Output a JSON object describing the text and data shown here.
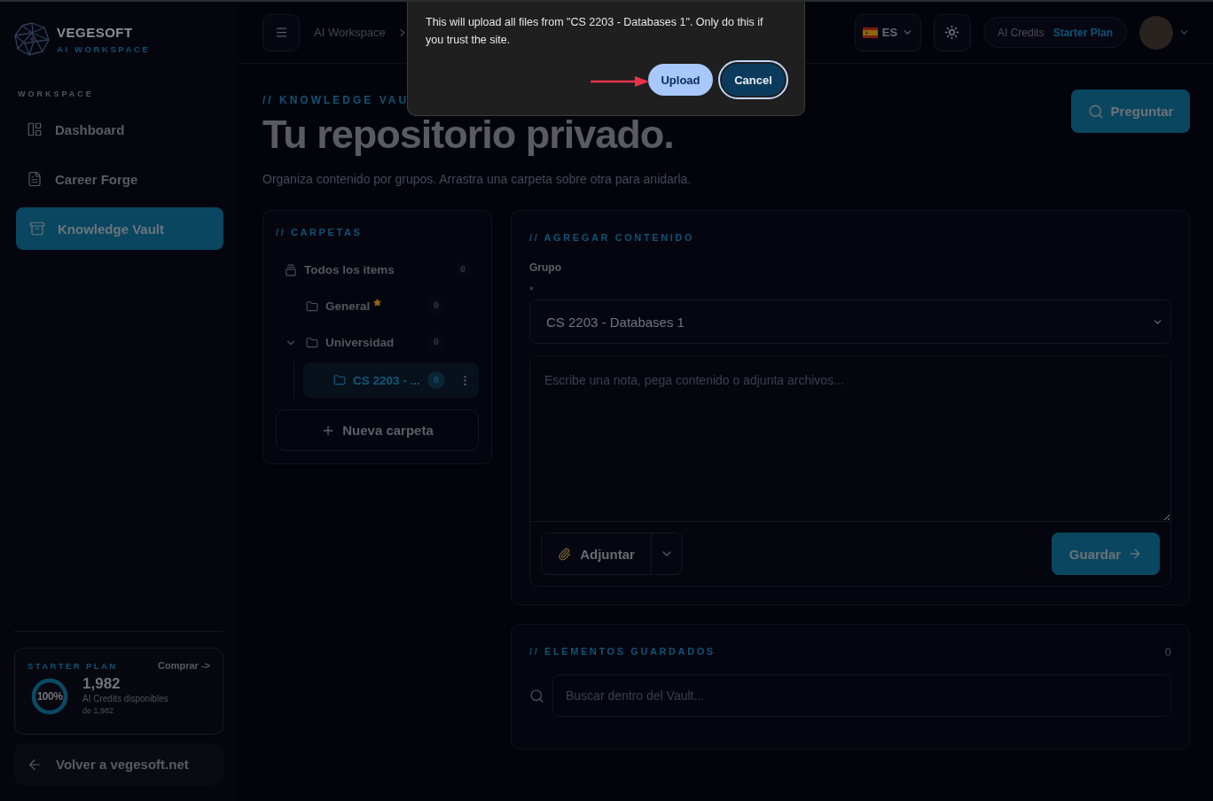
{
  "sidebar": {
    "brand": {
      "name": "VEGESOFT",
      "tagline": "AI WORKSPACE"
    },
    "section_label": "WORKSPACE",
    "items": [
      {
        "label": "Dashboard",
        "selected": false
      },
      {
        "label": "Career Forge",
        "selected": false
      },
      {
        "label": "Knowledge Vault",
        "selected": true
      }
    ],
    "credits": {
      "plan": "STARTER PLAN",
      "buy_link": "Comprar ->",
      "level": 1,
      "percent": "100%",
      "amount": "1,982",
      "caption": "AI Credits disponibles",
      "total": "de 1,982"
    },
    "back_link": "Volver a vegesoft.net"
  },
  "topbar": {
    "breadcrumb": [
      "AI Workspace"
    ],
    "language": "ES",
    "credits_label": "AI Credits",
    "plan": "Starter Plan"
  },
  "dialog": {
    "message": "This will upload all files from \"CS 2203 - Databases 1\". Only do this if you trust the site.",
    "buttons": [
      {
        "label": "Upload",
        "kind": "primary",
        "focused": false
      },
      {
        "label": "Cancel",
        "kind": "secondary",
        "focused": true
      }
    ]
  },
  "header": {
    "eyebrow": "// KNOWLEDGE VAU",
    "title": "Tu repositorio privado.",
    "subtitle": "Organiza contenido por grupos. Arrastra una carpeta sobre otra para anidarla.",
    "ask_button": "Preguntar"
  },
  "folders": {
    "title": "// CARPETAS",
    "all_items": {
      "label": "Todos los items",
      "count": "0",
      "selected": false
    },
    "items": [
      {
        "label": "General",
        "count": "0",
        "starred": true,
        "selected": false
      },
      {
        "label": "Universidad",
        "count": "0",
        "starred": false,
        "selected": false,
        "expanded": true,
        "children": [
          {
            "label": "CS 2203 - ...",
            "count": "0",
            "starred": false,
            "selected": true
          }
        ]
      }
    ],
    "new_button": "Nueva carpeta"
  },
  "add_content": {
    "title": "// AGREGAR CONTENIDO",
    "group_label": "Grupo",
    "required_mark": "*",
    "group_value": "CS 2203 - Databases 1",
    "note_placeholder": "Escribe una nota, pega contenido o adjunta archivos...",
    "attach_button": "Adjuntar",
    "save_button": "Guardar"
  },
  "saved": {
    "title": "// ELEMENTOS GUARDADOS",
    "count": "0",
    "search_placeholder": "Buscar dentro del Vault..."
  }
}
